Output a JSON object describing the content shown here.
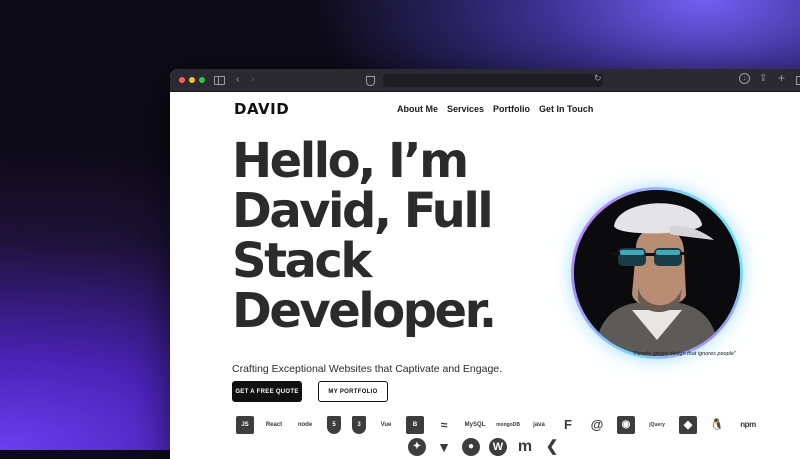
{
  "browser": {
    "address_text": ""
  },
  "site": {
    "logo": "DAVID",
    "nav": [
      "About Me",
      "Services",
      "Portfolio",
      "Get In Touch"
    ],
    "hero_lines": [
      "Hello, I’m",
      "David, Full",
      "Stack",
      "Developer."
    ],
    "subtitle": "Crafting Exceptional Websites that Captivate and Engage.",
    "cta_primary": "GET A FREE QUOTE",
    "cta_secondary": "MY PORTFOLIO",
    "quote": "\"People ignore design that ignores people\""
  },
  "tech_row1": [
    {
      "icon": "javascript-icon",
      "label": "JS"
    },
    {
      "icon": "react-icon",
      "label": "React"
    },
    {
      "icon": "nodejs-icon",
      "label": "node"
    },
    {
      "icon": "html5-icon",
      "label": "5"
    },
    {
      "icon": "css3-icon",
      "label": "3"
    },
    {
      "icon": "vue-icon",
      "label": "Vue"
    },
    {
      "icon": "bootstrap-icon",
      "label": "B"
    },
    {
      "icon": "tailwind-icon",
      "label": "≈"
    },
    {
      "icon": "mysql-icon",
      "label": "MySQL"
    },
    {
      "icon": "mongodb-icon",
      "label": "mongoDB"
    },
    {
      "icon": "java-icon",
      "label": "java"
    },
    {
      "icon": "figma-icon",
      "label": "F"
    },
    {
      "icon": "debian-icon",
      "label": "@"
    },
    {
      "icon": "ubuntu-icon",
      "label": "◉"
    },
    {
      "icon": "jquery-icon",
      "label": "jQuery"
    },
    {
      "icon": "git-icon",
      "label": "◆"
    },
    {
      "icon": "linux-icon",
      "label": "🐧"
    },
    {
      "icon": "npm-icon",
      "label": "npm"
    }
  ],
  "tech_row2": [
    {
      "icon": "postman-icon",
      "label": "✦"
    },
    {
      "icon": "vite-icon",
      "label": "▼"
    },
    {
      "icon": "github-icon",
      "label": "●"
    },
    {
      "icon": "wordpress-icon",
      "label": "W"
    },
    {
      "icon": "mailchimp-icon",
      "label": "m"
    },
    {
      "icon": "vscode-icon",
      "label": "❮"
    }
  ],
  "colors": {
    "accent_ring": "#7dd3fc",
    "accent_ring_2": "#a78bfa",
    "text": "#2b2b2b"
  }
}
